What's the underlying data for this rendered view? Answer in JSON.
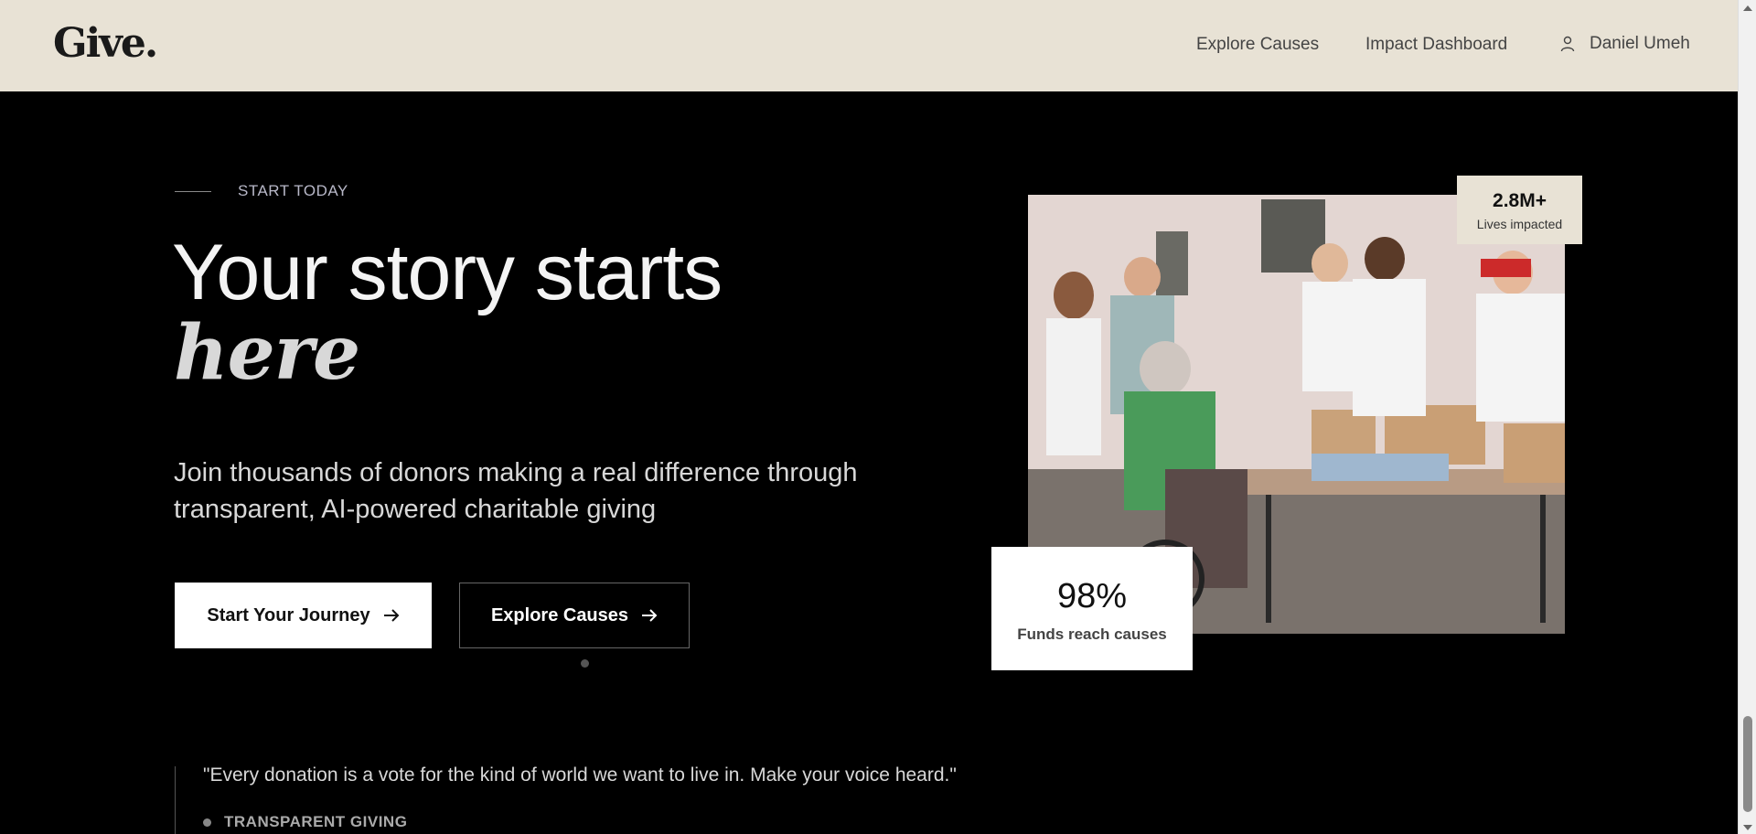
{
  "header": {
    "logo": "Give.",
    "nav": {
      "explore_causes": "Explore Causes",
      "impact_dashboard": "Impact Dashboard",
      "user_name": "Daniel Umeh"
    }
  },
  "hero": {
    "eyebrow": "START TODAY",
    "headline": "Your story starts",
    "headline_italic": "here",
    "subhead": "Join thousands of donors making a real difference through transparent, AI-powered charitable giving",
    "primary_button": "Start Your Journey",
    "secondary_button": "Explore Causes"
  },
  "stats": {
    "lives_value": "2.8M+",
    "lives_label": "Lives impacted",
    "funds_value": "98%",
    "funds_label": "Funds reach causes"
  },
  "quote": {
    "text": "\"Every donation is a vote for the kind of world we want to live in. Make your voice heard.\"",
    "tag": "TRANSPARENT GIVING"
  },
  "colors": {
    "header_bg": "#e8e2d5",
    "page_bg": "#000000",
    "primary_button_bg": "#ffffff"
  },
  "icons": {
    "user": "user-icon",
    "arrow": "arrow-right-icon"
  }
}
